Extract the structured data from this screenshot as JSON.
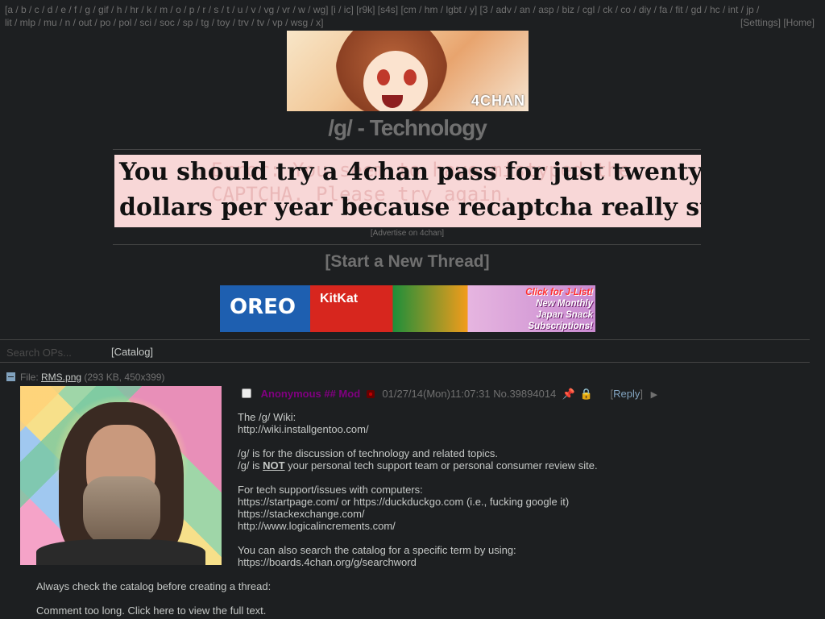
{
  "nav": {
    "links_row1": "[a / b / c / d / e / f / g / gif / h / hr / k / m / o / p / r / s / t / u / v / vg / vr / w / wg] [i / ic] [r9k] [s4s] [cm / hm / lgbt / y] [3 / adv / an / asp / biz / cgl / ck / co / diy / fa / fit / gd / hc / int / jp /",
    "links_row2": "lit / mlp / mu / n / out / po / pol / sci / soc / sp / tg / toy / trv / tv / vp / wsg / x]",
    "settings": "[Settings]",
    "home": "[Home]"
  },
  "banner": {
    "logo_text": "4CHAN"
  },
  "board": {
    "title": "/g/ - Technology"
  },
  "ad": {
    "line1": "You should try a 4chan pass for just twenty",
    "line2": "dollars per year because recaptcha really suX",
    "ghost_text": "Error: You seem to have mistyped the CAPTCHA. Please try again.",
    "advertise_link": "[Advertise on 4chan]"
  },
  "new_thread": "[Start a New Thread]",
  "ad2": {
    "brand1": "OREO",
    "brand2": "KitKat",
    "cta_line1": "Click for J-List!",
    "cta_line2": "New Monthly",
    "cta_line3": "Japan Snack",
    "cta_line4": "Subscriptions!"
  },
  "search": {
    "placeholder": "Search OPs..."
  },
  "catalog_link": "[Catalog]",
  "file": {
    "label": "File:",
    "name": "RMS.png",
    "meta": "(293 KB, 450x399)"
  },
  "post": {
    "name": "Anonymous ## Mod",
    "datetime": "01/27/14(Mon)11:07:31",
    "number": "No.39894014",
    "reply_label": "Reply",
    "lines": [
      "The /g/ Wiki:",
      "http://wiki.installgentoo.com/",
      "",
      "/g/ is for the discussion of technology and related topics.",
      "",
      "",
      "For tech support/issues with computers:",
      "https://startpage.com/ or https://duckduckgo.com (i.e., fucking google it)",
      "https://stackexchange.com/",
      "http://www.logicalincrements.com/",
      "",
      "You can also search the catalog for a specific term by using:",
      "https://boards.4chan.org/g/searchword"
    ],
    "line5_pre": "/g/ is ",
    "line5_bold": "NOT",
    "line5_post": " your personal tech support team or personal consumer review site.",
    "tail1": "Always check the catalog before creating a thread:",
    "tail2": "Comment too long. Click here to view the full text."
  }
}
